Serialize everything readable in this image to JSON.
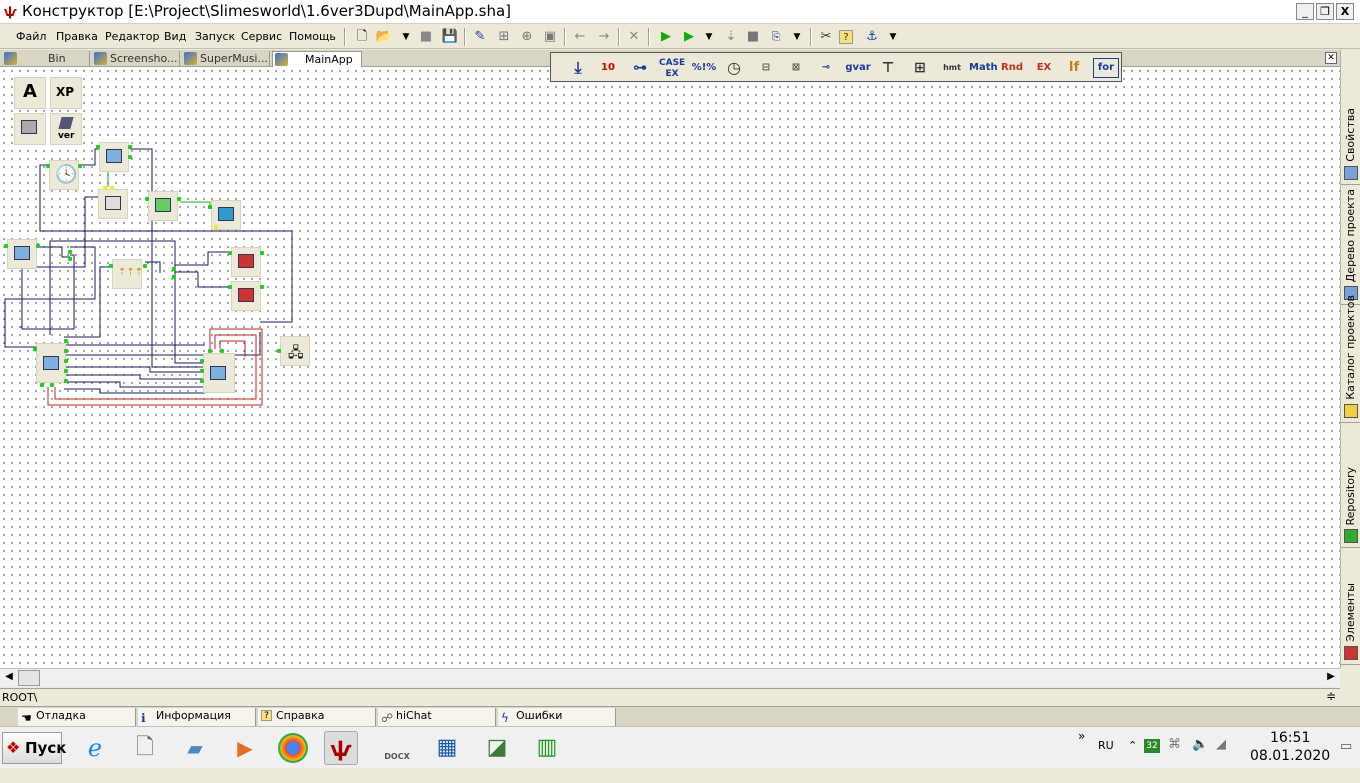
{
  "window": {
    "title": "Конструктор [E:\\Project\\Slimesworld\\1.6ver3Dupd\\MainApp.sha]",
    "minimize": "_",
    "restore": "❐",
    "close": "X"
  },
  "menu": [
    "Файл",
    "Правка",
    "Редактор",
    "Вид",
    "Запуск",
    "Сервис",
    "Помощь"
  ],
  "toolbar_icons": [
    "new-file-icon",
    "open-folder-icon",
    "dropdown-icon",
    "stop-icon",
    "save-icon",
    "edit-icon",
    "align-icon",
    "align-center-icon",
    "fit-icon",
    "back-arrow-icon",
    "forward-arrow-icon",
    "delete-icon",
    "run-icon",
    "debug-run-icon",
    "dropdown-icon",
    "step-icon",
    "stop-square-icon",
    "compile-icon",
    "dropdown-icon",
    "tools-icon",
    "help-icon",
    "anchor-icon",
    "dropdown-icon"
  ],
  "doc_tabs": [
    {
      "label": "Bin",
      "active": false
    },
    {
      "label": "Screensho...",
      "active": false
    },
    {
      "label": "SuperMusi...",
      "active": false
    },
    {
      "label": "MainApp",
      "active": true
    }
  ],
  "palette": [
    "10",
    "CASE EX",
    "%!%",
    "gvar",
    "hmt",
    "Math",
    "Rnd",
    "EX",
    "If",
    "for"
  ],
  "left_tools": {
    "text_tool": "A",
    "xp_tool": "XP",
    "ver_tool": "ver"
  },
  "sidebar_tabs": [
    "Свойства",
    "Дерево проекта",
    "Каталог проектов",
    "Repository",
    "Элементы"
  ],
  "status": {
    "path": "ROOT\\"
  },
  "bottom_tabs": [
    "Отладка",
    "Информация",
    "Справка",
    "hiChat",
    "Ошибки"
  ],
  "taskbar": {
    "start_label": "Пуск",
    "lang": "RU",
    "badge": "32",
    "time": "16:51",
    "date": "08.01.2020",
    "docx_label": "DOCX"
  },
  "colors": {
    "wire_dark": "#1a1a5a",
    "wire_red": "#c02020",
    "pin": "#22cc22"
  }
}
